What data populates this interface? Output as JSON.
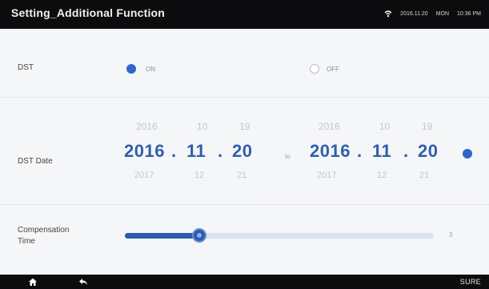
{
  "header": {
    "title": "Setting_Additional Function",
    "date": "2016.11.20",
    "day": "MON",
    "time": "10:36 PM"
  },
  "dst": {
    "label": "DST",
    "on_label": "ON",
    "off_label": "OFF",
    "selected": "ON"
  },
  "dst_date": {
    "label": "DST Date",
    "to_label": "to",
    "start": {
      "prev": {
        "year": "2016",
        "month": "10",
        "day": "19"
      },
      "current": {
        "year": "2016",
        "month": "11",
        "day": "20"
      },
      "next": {
        "year": "2017",
        "month": "12",
        "day": "21"
      }
    },
    "end": {
      "prev": {
        "year": "2016",
        "month": "10",
        "day": "19"
      },
      "current": {
        "year": "2016",
        "month": "11",
        "day": "20"
      },
      "next": {
        "year": "2017",
        "month": "12",
        "day": "21"
      }
    }
  },
  "compensation": {
    "label_line1": "Compensation",
    "label_line2": "Time",
    "value_fraction": 0.24,
    "max_label": "3"
  },
  "footer": {
    "sure_label": "SURE"
  },
  "colors": {
    "accent": "#2f5fae",
    "topbar": "#0c0c0e"
  }
}
